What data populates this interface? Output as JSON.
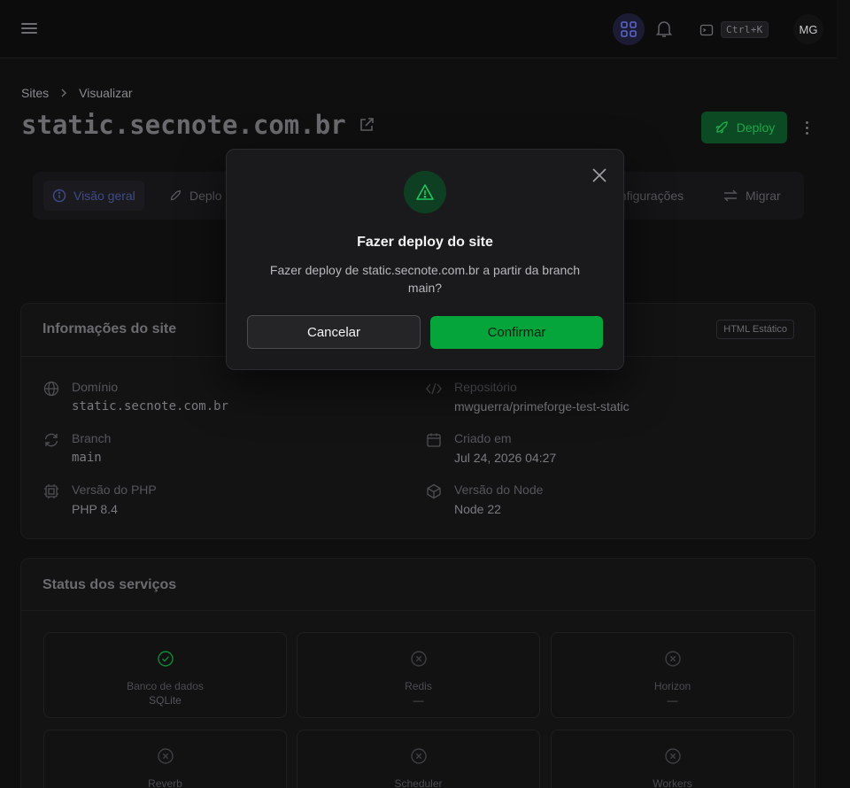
{
  "topbar": {
    "shortcut": "Ctrl+K",
    "avatar_initials": "MG"
  },
  "breadcrumb": {
    "root": "Sites",
    "current": "Visualizar"
  },
  "page": {
    "title": "static.secnote.com.br",
    "deploy_label": "Deploy"
  },
  "tabs": [
    {
      "label": "Visão geral",
      "icon": "info-icon",
      "active": true
    },
    {
      "label": "Deplo",
      "icon": "rocket-icon"
    },
    {
      "label": "onfigurações",
      "icon": "gear-icon"
    },
    {
      "label": "Migrar",
      "icon": "arrows-icon"
    }
  ],
  "site_info": {
    "title": "Informações do site",
    "badge": "HTML Estático",
    "items": [
      {
        "label": "Domínio",
        "value": "static.secnote.com.br",
        "icon": "globe-icon"
      },
      {
        "label": "Repositório",
        "value": "mwguerra/primeforge-test-static",
        "icon": "code-icon"
      },
      {
        "label": "Branch",
        "value": "main",
        "icon": "refresh-icon"
      },
      {
        "label": "Criado em",
        "value": "Jul 24, 2026 04:27",
        "icon": "calendar-icon"
      },
      {
        "label": "Versão do PHP",
        "value": "PHP 8.4",
        "icon": "chip-icon"
      },
      {
        "label": "Versão do Node",
        "value": "Node 22",
        "icon": "cube-icon"
      }
    ]
  },
  "services": {
    "title": "Status dos serviços",
    "items": [
      {
        "name": "Banco de dados",
        "detail": "SQLite",
        "status": "ok"
      },
      {
        "name": "Redis",
        "detail": "—",
        "status": "off"
      },
      {
        "name": "Horizon",
        "detail": "—",
        "status": "off"
      },
      {
        "name": "Reverb",
        "detail": "",
        "status": "off"
      },
      {
        "name": "Scheduler",
        "detail": "",
        "status": "off"
      },
      {
        "name": "Workers",
        "detail": "",
        "status": "off"
      }
    ]
  },
  "modal": {
    "title": "Fazer deploy do site",
    "message": "Fazer deploy de static.secnote.com.br a partir da branch main?",
    "cancel_label": "Cancelar",
    "confirm_label": "Confirmar"
  },
  "colors": {
    "accent_green": "#05a53c",
    "background": "#0f0f10",
    "modal_bg": "#1a1a1c"
  }
}
